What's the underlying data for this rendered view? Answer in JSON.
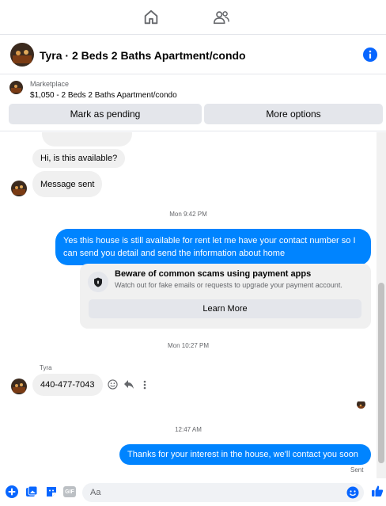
{
  "colors": {
    "accent": "#0084ff",
    "gray_bubble": "#f0f0f0",
    "muted": "#65676b"
  },
  "topnav": {
    "icons": [
      "home-icon",
      "friends-icon"
    ]
  },
  "header": {
    "title": "Tyra · 2 Beds 2 Baths Apartment/condo",
    "icon": "info-icon"
  },
  "marketplace": {
    "label": "Marketplace",
    "listing": "$1,050 - 2 Beds 2 Baths Apartment/condo",
    "mark_pending": "Mark as pending",
    "more_options": "More options"
  },
  "thread": {
    "msg_available": "Hi, is this available?",
    "msg_sent": "Message sent",
    "ts1": "Mon 9:42 PM",
    "reply1": "Yes this house is still available for rent let me have your contact number so I can send you detail and send the information about home",
    "scam": {
      "title": "Beware of common scams using payment apps",
      "desc": "Watch out for fake emails or requests to upgrade your payment account.",
      "learn_more": "Learn More"
    },
    "ts2": "Mon 10:27 PM",
    "sender": "Tyra",
    "phone": "440-477-7043",
    "ts3": "12:47 AM",
    "reply2": "Thanks for your interest in the house, we'll contact you soon",
    "status": "Sent"
  },
  "composer": {
    "placeholder": "Aa",
    "icons": [
      "add-icon",
      "photo-icon",
      "sticker-icon",
      "gif-icon",
      "emoji-icon",
      "like-icon"
    ],
    "gif_label": "GIF"
  }
}
